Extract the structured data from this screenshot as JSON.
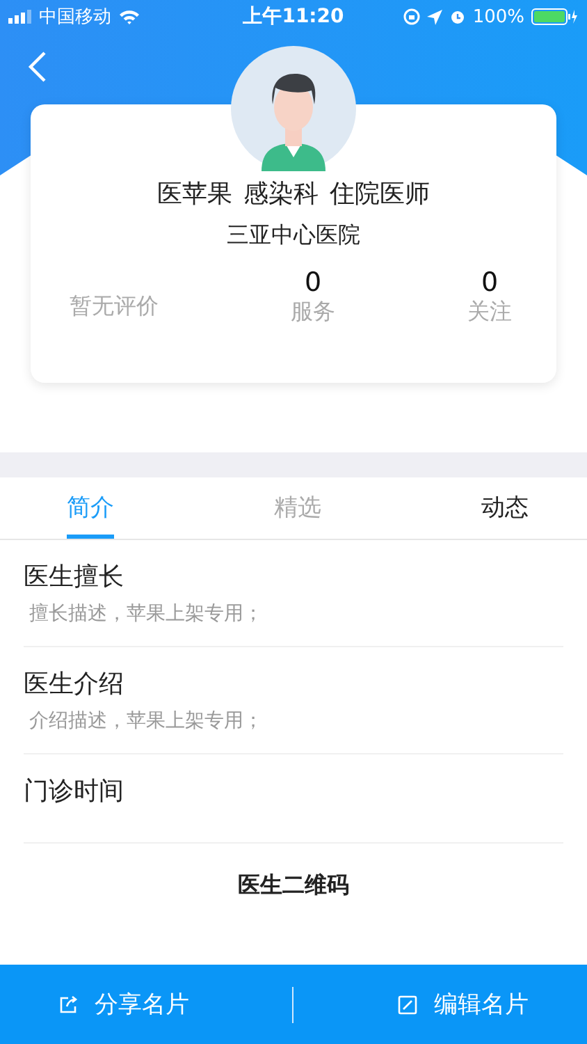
{
  "status_bar": {
    "carrier": "中国移动",
    "time": "上午11:20",
    "battery": "100%"
  },
  "profile": {
    "name": "医苹果",
    "department": "感染科",
    "title": "住院医师",
    "hospital": "三亚中心医院",
    "rating": "暂无评价",
    "stats": [
      {
        "value": "0",
        "label": "服务"
      },
      {
        "value": "0",
        "label": "关注"
      }
    ]
  },
  "tabs": [
    {
      "label": "简介",
      "selected": true,
      "disabled": false
    },
    {
      "label": "精选",
      "selected": false,
      "disabled": true
    },
    {
      "label": "动态",
      "selected": false,
      "disabled": false
    }
  ],
  "sections": [
    {
      "title": "医生擅长",
      "description": "擅长描述，苹果上架专用；"
    },
    {
      "title": "医生介绍",
      "description": "介绍描述，苹果上架专用；"
    },
    {
      "title": "门诊时间"
    }
  ],
  "qr_link": "医生二维码",
  "bottom_buttons": [
    {
      "label": "分享名片",
      "kind": "share"
    },
    {
      "label": "编辑名片",
      "kind": "edit"
    }
  ]
}
